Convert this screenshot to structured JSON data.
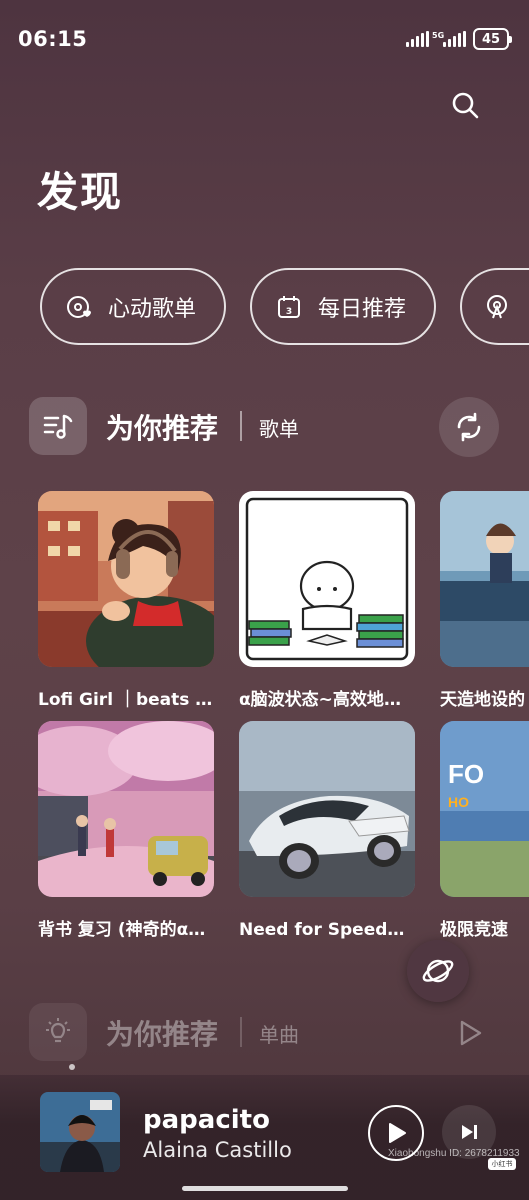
{
  "status_bar": {
    "time": "06:15",
    "battery": "45",
    "net_label": "5G"
  },
  "header": {
    "title": "发现",
    "search_icon": "search-icon"
  },
  "chips": [
    {
      "label": "心动歌单",
      "icon": "heart-disc-icon"
    },
    {
      "label": "每日推荐",
      "icon": "calendar-icon",
      "icon_text": "3"
    },
    {
      "label": "",
      "icon": "radio-icon"
    }
  ],
  "playlist_section": {
    "title": "为你推荐",
    "subtitle": "歌单",
    "icon": "playlist-music-icon",
    "action_icon": "refresh-icon",
    "cards": [
      {
        "title": "Lofi Girl ｜beats to relax/study to",
        "cover": "lofi-girl-cover"
      },
      {
        "title": "α脑波状态~高效地学习",
        "cover": "doodle-study-cover"
      },
      {
        "title": "天造地设的",
        "cover": "piano-anime-cover"
      },
      {
        "title": "背书 复习 (神奇的α脑波)",
        "cover": "cherry-blossom-cover"
      },
      {
        "title": "Need for Speed极品飞车",
        "cover": "race-car-cover"
      },
      {
        "title": "极限竞速",
        "cover": "forza-cover",
        "cover_text": "FO",
        "cover_text2": "HO"
      }
    ]
  },
  "songs_section": {
    "title": "为你推荐",
    "subtitle": "单曲",
    "icon": "lightbulb-icon",
    "action_icon": "play-outline-icon"
  },
  "floating_icon": "planet-icon",
  "player": {
    "song": "papacito",
    "artist": "Alaina Castillo",
    "play_icon": "play-icon",
    "next_icon": "next-icon"
  },
  "watermark": "Xiaohongshu ID: 2678211933",
  "watermark_badge": "小红书",
  "colors": {
    "background": "#5a3e47",
    "accent": "#ffffff"
  }
}
